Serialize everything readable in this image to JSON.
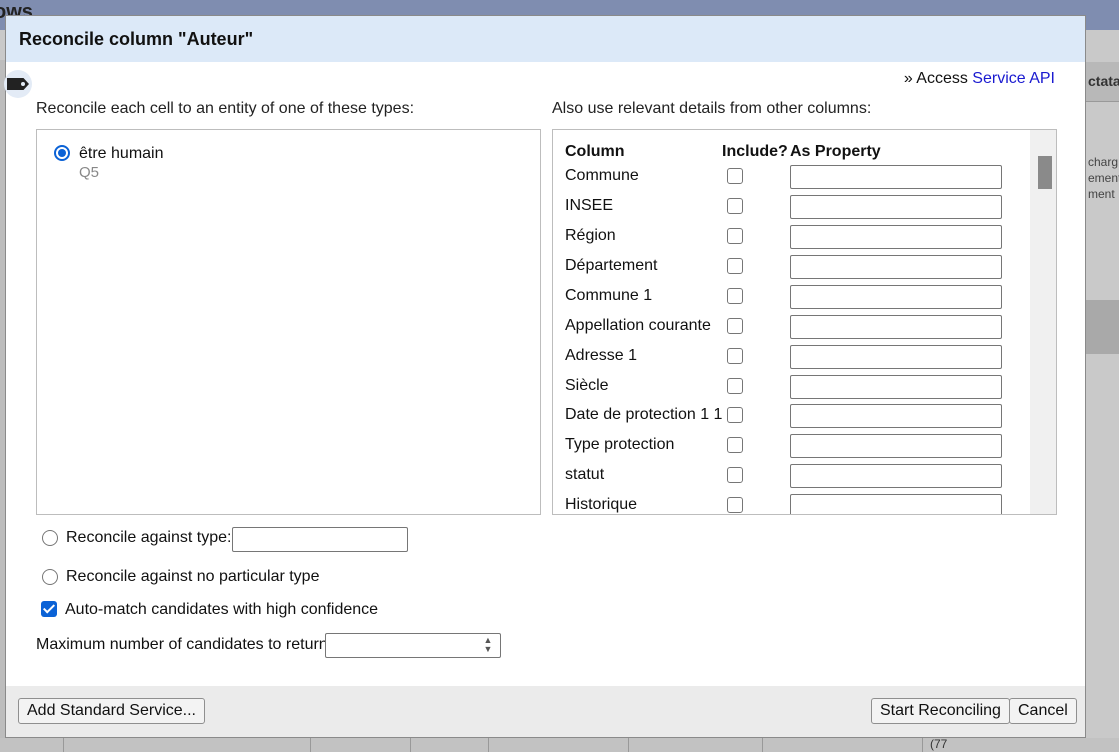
{
  "background": {
    "title": "ows",
    "right_header": "ctatai",
    "right_text": [
      "charg",
      "ement",
      "ment"
    ],
    "bottom_text": "(77"
  },
  "dialog": {
    "title": "Reconcile column \"Auteur\"",
    "access_prefix": "» Access ",
    "access_link": "Service API",
    "types_label": "Reconcile each cell to an entity of one of these types:",
    "types": [
      {
        "name": "être humain",
        "id": "Q5",
        "selected": true
      }
    ],
    "columns_label": "Also use relevant details from other columns:",
    "columns_header": {
      "column": "Column",
      "include": "Include?",
      "property": "As Property"
    },
    "columns": [
      {
        "name": "Commune",
        "include": false,
        "property": ""
      },
      {
        "name": "INSEE",
        "include": false,
        "property": ""
      },
      {
        "name": "Région",
        "include": false,
        "property": ""
      },
      {
        "name": "Département",
        "include": false,
        "property": ""
      },
      {
        "name": "Commune 1",
        "include": false,
        "property": ""
      },
      {
        "name": "Appellation courante",
        "include": false,
        "property": ""
      },
      {
        "name": "Adresse 1",
        "include": false,
        "property": ""
      },
      {
        "name": "Siècle",
        "include": false,
        "property": ""
      },
      {
        "name": "Date de protection 1 1",
        "include": false,
        "property": ""
      },
      {
        "name": "Type protection",
        "include": false,
        "property": ""
      },
      {
        "name": "statut",
        "include": false,
        "property": ""
      },
      {
        "name": "Historique",
        "include": false,
        "property": ""
      }
    ],
    "options": {
      "against_type_label": "Reconcile against type:",
      "against_type_value": "",
      "no_type_label": "Reconcile against no particular type",
      "auto_match_label": "Auto-match candidates with high confidence",
      "auto_match_checked": true,
      "max_candidates_label": "Maximum number of candidates to return",
      "max_candidates_value": ""
    },
    "buttons": {
      "add_service": "Add Standard Service...",
      "start": "Start Reconciling",
      "cancel": "Cancel"
    }
  },
  "colors": {
    "header_bg": "#dce9f8",
    "accent": "#0b62d6",
    "link": "#1a1ad0"
  }
}
